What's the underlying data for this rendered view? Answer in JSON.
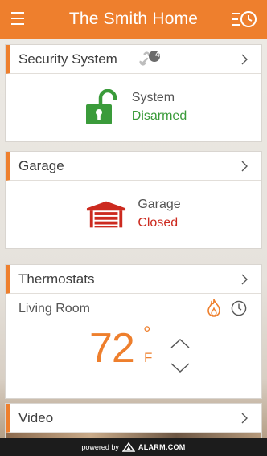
{
  "header": {
    "title": "The Smith Home"
  },
  "security": {
    "title": "Security System",
    "badge_count": "4",
    "label": "System",
    "status": "Disarmed",
    "status_color": "#3a9b3a"
  },
  "garage": {
    "title": "Garage",
    "label": "Garage",
    "status": "Closed",
    "status_color": "#cc2a1f"
  },
  "thermostat": {
    "title": "Thermostats",
    "room": "Living Room",
    "temperature": "72",
    "degree": "°",
    "unit": "F"
  },
  "video": {
    "title": "Video"
  },
  "footer": {
    "powered_by": "powered by",
    "brand": "ALARM.COM"
  },
  "colors": {
    "accent": "#ee7f2d",
    "disarmed": "#3a9b3a",
    "closed": "#cc2a1f"
  }
}
